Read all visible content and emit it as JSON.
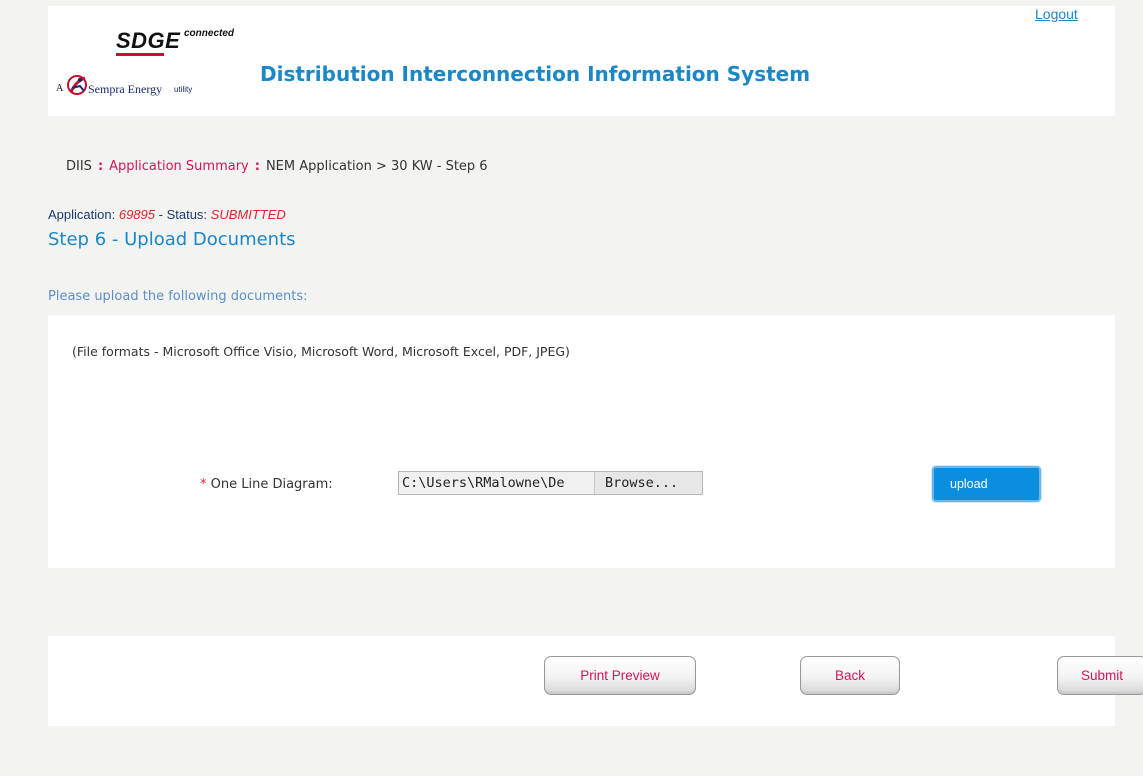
{
  "header": {
    "logo": {
      "sdge_text": "SDGE",
      "connected_text": "connected",
      "a_text": "A",
      "sempra_text": "Sempra Energy",
      "utility_text": "utility"
    },
    "app_title": "Distribution Interconnection Information System",
    "logout_label": "Logout"
  },
  "breadcrumb": {
    "root": "DIIS",
    "link": "Application Summary",
    "current": "NEM Application > 30 KW - Step 6"
  },
  "application": {
    "label_prefix": "Application:",
    "number": "69895",
    "status_sep": "- Status:",
    "status": "SUBMITTED"
  },
  "step_title": "Step 6 - Upload Documents",
  "instructions": "Please upload the following documents:",
  "upload": {
    "formats_note": "(File formats - Microsoft Office Visio, Microsoft Word, Microsoft Excel, PDF, JPEG)",
    "required_mark": "*",
    "field_label": "One Line Diagram:",
    "file_path": "C:\\Users\\RMalowne\\De",
    "browse_label": "Browse...",
    "upload_label": "upload"
  },
  "actions": {
    "print_preview": "Print Preview",
    "back": "Back",
    "submit": "Submit"
  },
  "colors": {
    "accent_blue": "#1a87c9",
    "link_red": "#d4145a",
    "status_red": "#e8202f",
    "upload_button": "#0a8fdf"
  },
  "icons": [
    "breadcrumb-separator-icon",
    "sempra-swoosh-icon"
  ]
}
